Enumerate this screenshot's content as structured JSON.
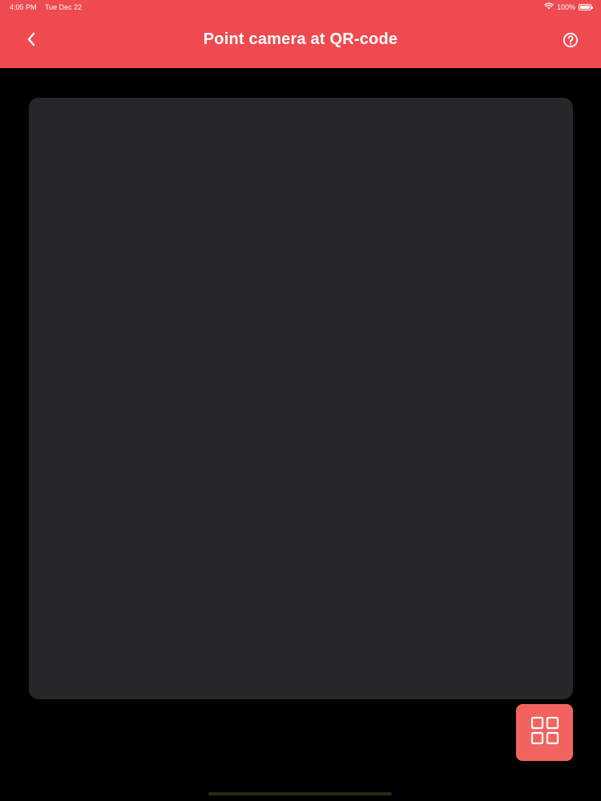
{
  "status_bar": {
    "time": "4:05 PM",
    "date": "Tue Dec 22",
    "battery": "100%"
  },
  "header": {
    "title": "Point camera at QR-code",
    "back_icon": "chevron-left-icon",
    "help_icon": "question-circle-icon",
    "background_color": "#ef4a4f"
  },
  "scanner": {
    "viewport_color": "#272729"
  },
  "actions": {
    "grid_icon": "grid-icon",
    "button_color": "#f26360"
  }
}
